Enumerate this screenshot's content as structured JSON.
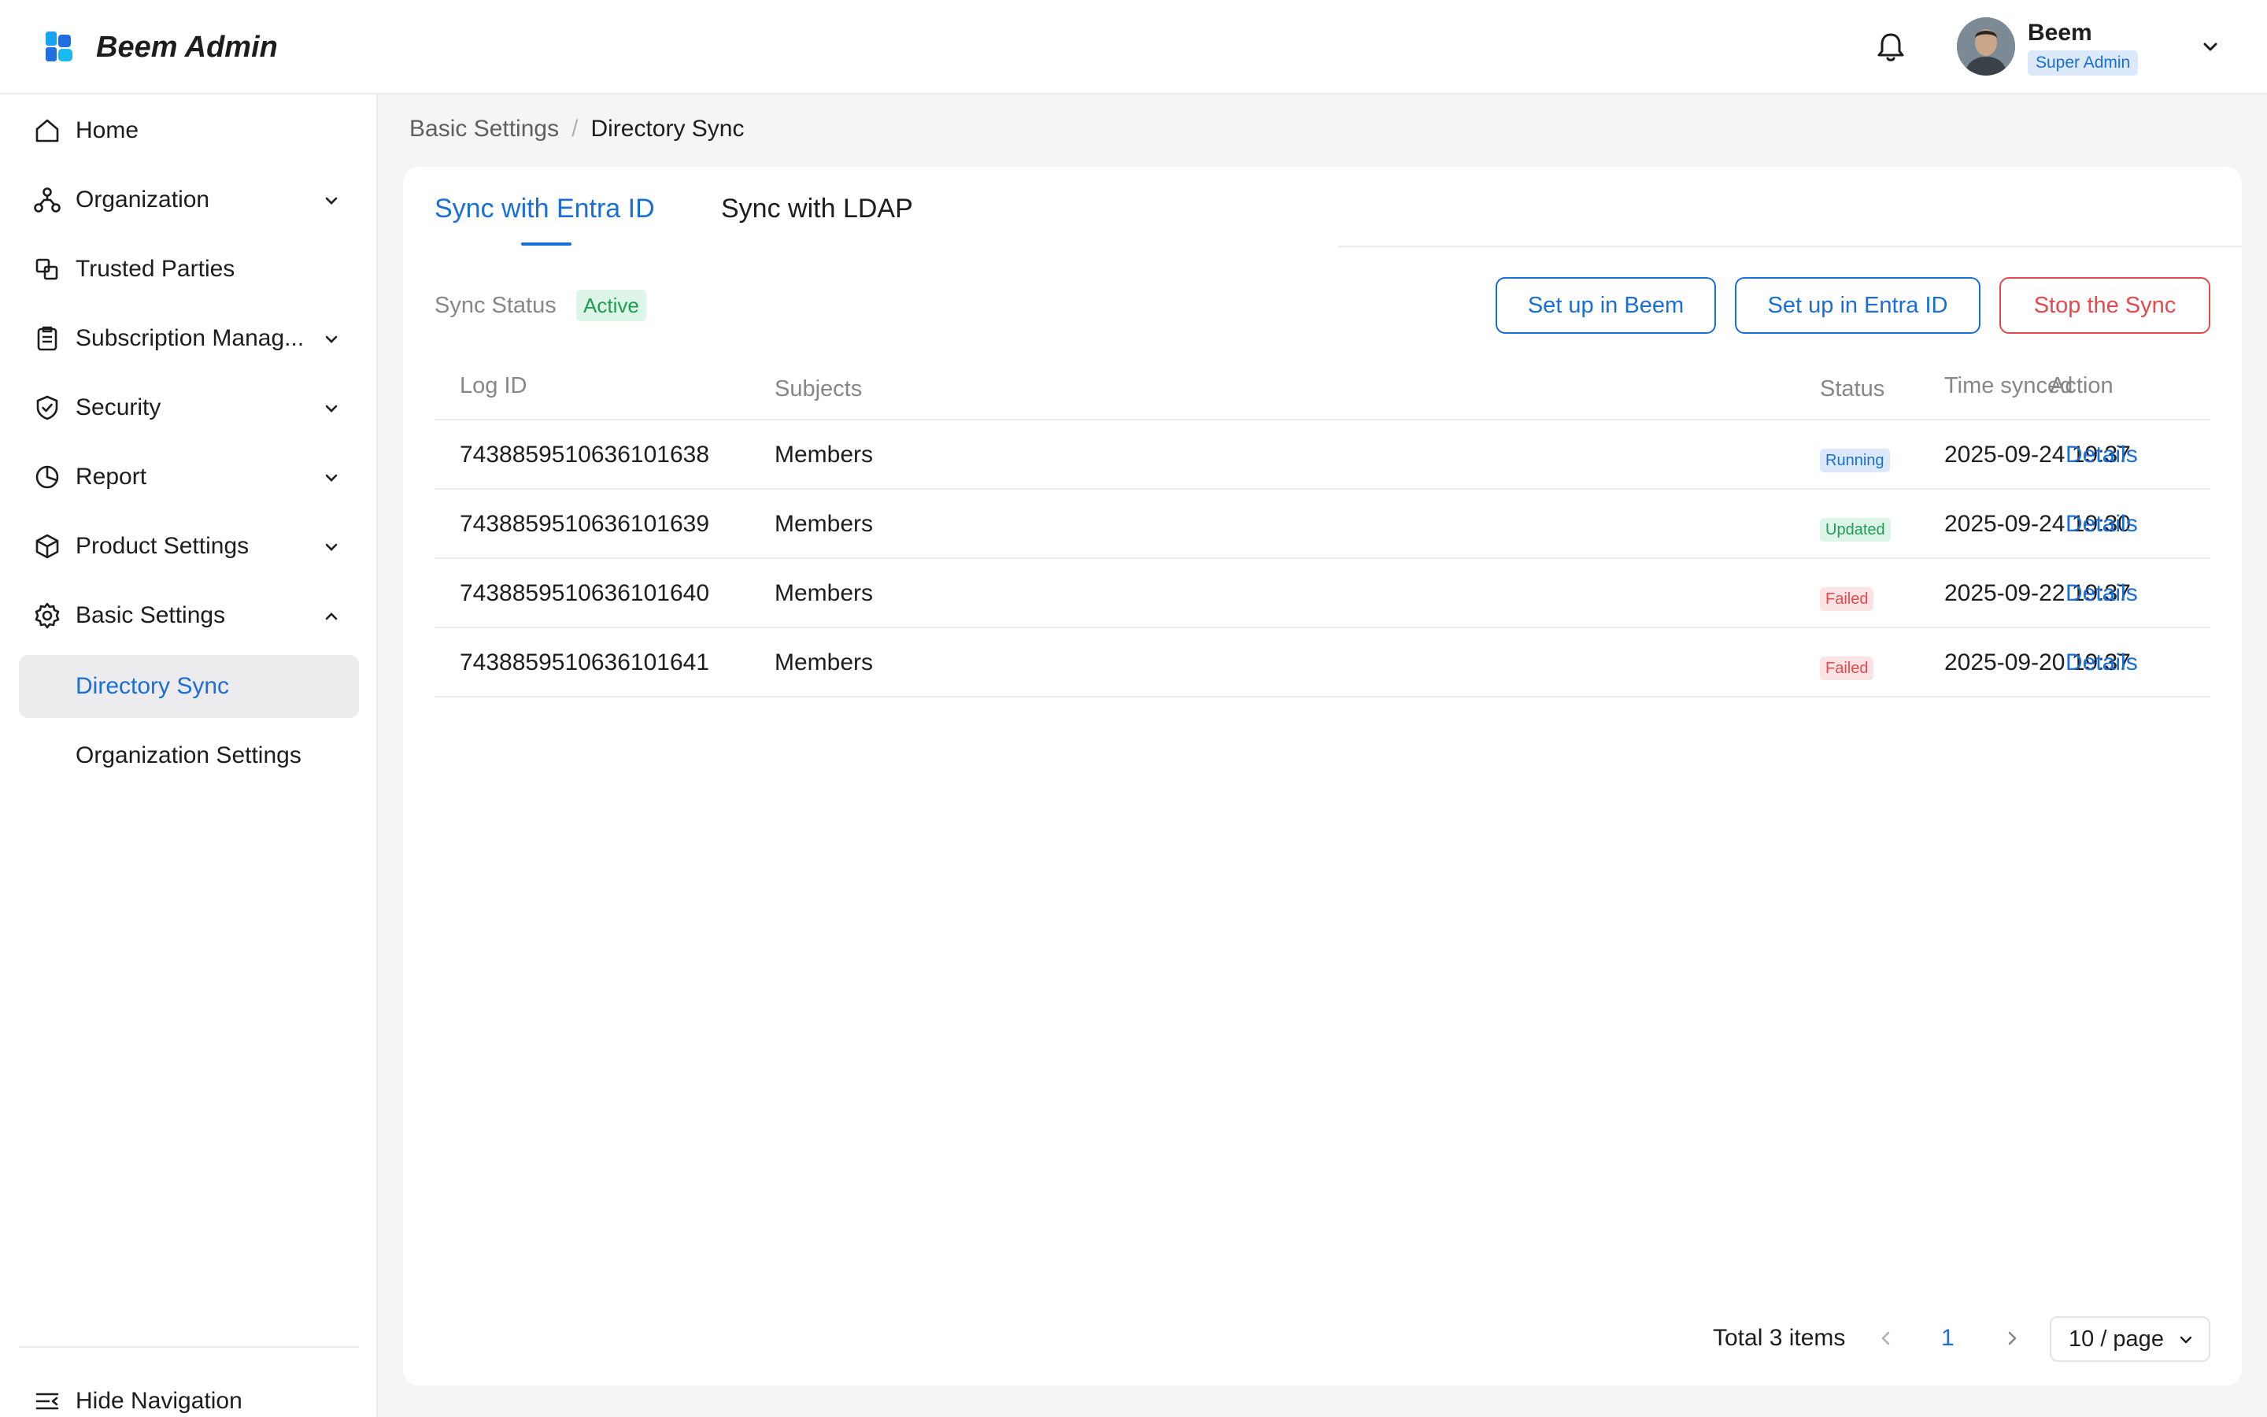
{
  "header": {
    "app_title": "Beem Admin",
    "user_name": "Beem",
    "user_role": "Super Admin",
    "brand_color": "#1a6ed8",
    "icons": [
      "beem-logo-icon",
      "bell-icon",
      "avatar",
      "chevron-down-icon"
    ]
  },
  "sidebar": {
    "items": [
      {
        "label": "Home",
        "icon": "home-icon",
        "expandable": false
      },
      {
        "label": "Organization",
        "icon": "org-chart-icon",
        "expandable": true
      },
      {
        "label": "Trusted Parties",
        "icon": "linked-squares-icon",
        "expandable": false
      },
      {
        "label": "Subscription Manag...",
        "icon": "clipboard-icon",
        "expandable": true
      },
      {
        "label": "Security",
        "icon": "shield-icon",
        "expandable": true
      },
      {
        "label": "Report",
        "icon": "pie-chart-icon",
        "expandable": true
      },
      {
        "label": "Product Settings",
        "icon": "box-icon",
        "expandable": true
      },
      {
        "label": "Basic Settings",
        "icon": "gear-icon",
        "expandable": true,
        "expanded": true
      }
    ],
    "sub_items": [
      {
        "label": "Directory Sync",
        "active": true
      },
      {
        "label": "Organization Settings",
        "active": false
      }
    ],
    "hide_nav_label": "Hide Navigation"
  },
  "breadcrumb": {
    "parent": "Basic Settings",
    "separator": "/",
    "current": "Directory Sync"
  },
  "tabs": [
    {
      "label": "Sync with Entra ID",
      "active": true
    },
    {
      "label": "Sync with LDAP",
      "active": false
    }
  ],
  "sync": {
    "status_label": "Sync Status",
    "status_value": "Active"
  },
  "actions": {
    "setup_beem": "Set up in Beem",
    "setup_entra": "Set up in Entra ID",
    "stop_sync": "Stop the Sync"
  },
  "table": {
    "columns": [
      "Log ID",
      "Subjects",
      "Time synced",
      "Status",
      "Action"
    ],
    "rows": [
      {
        "log_id": "7438859510636101638",
        "subjects": "Members",
        "time": "2025-09-24 19:37",
        "status": "Running",
        "action": "Details"
      },
      {
        "log_id": "7438859510636101639",
        "subjects": "Members",
        "time": "2025-09-24 19:30",
        "status": "Updated",
        "action": "Details"
      },
      {
        "log_id": "7438859510636101640",
        "subjects": "Members",
        "time": "2025-09-22 19:37",
        "status": "Failed",
        "action": "Details"
      },
      {
        "log_id": "7438859510636101641",
        "subjects": "Members",
        "time": "2025-09-20 19:37",
        "status": "Failed",
        "action": "Details"
      }
    ]
  },
  "pagination": {
    "total_text": "Total 3 items",
    "current_page": "1",
    "page_size": "10 / page"
  }
}
